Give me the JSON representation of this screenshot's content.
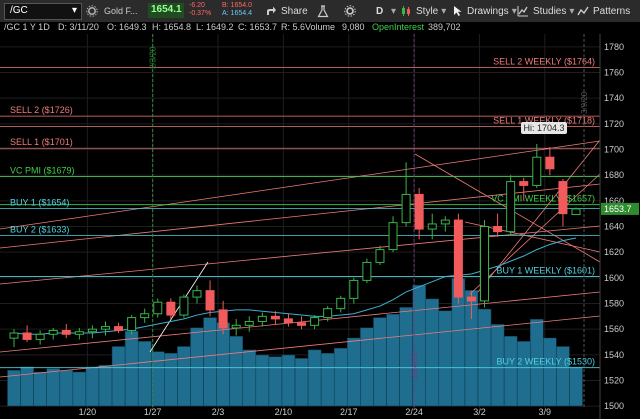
{
  "toolbar": {
    "symbol": "/GC",
    "symbol_chevron": "▾",
    "description": "Gold F...",
    "price": "1654.1",
    "change": "-6.20",
    "change_pct": "-0.37%",
    "bid": "B: 1654.0",
    "ask": "A: 1654.4",
    "share_label": "Share",
    "style_label": "Style",
    "drawings_label": "Drawings",
    "studies_label": "Studies",
    "patterns_label": "Patterns",
    "period_label": "D",
    "icons": [
      "gear-icon",
      "share-icon",
      "flask-icon",
      "drawings-icon",
      "studies-icon",
      "patterns-icon",
      "cursor-icon",
      "zoom-icon",
      "grid-icon"
    ]
  },
  "infobar": {
    "title": "/GC 1 Y 1D",
    "date": "D: 3/11/20",
    "open": "O: 1649.3",
    "high": "H: 1654.8",
    "low": "L: 1649.2",
    "close": "C: 1653.7",
    "range": "R: 5.6",
    "volume_label": "Volume",
    "volume_value": "9,080",
    "oi_label": "OpenInterest",
    "oi_value": "389,702"
  },
  "colors": {
    "up": "#39b54a",
    "down": "#f25b5b",
    "volume": "#1f6d8f",
    "pmi": "#3fd04a",
    "level": "#f07b7b",
    "buy": "#4fd2e0",
    "ma": "#3fb0d0",
    "last_price_bg": "#2e8b2e"
  },
  "chart_data": {
    "type": "candlestick",
    "x_ticks": [
      "1/20",
      "1/27",
      "2/3",
      "2/10",
      "2/17",
      "2/24",
      "3/2",
      "3/9"
    ],
    "y_ticks": [
      "1500",
      "1520",
      "1540",
      "1560",
      "1580",
      "1600",
      "1620",
      "1640",
      "1660",
      "1680",
      "1700",
      "1720",
      "1740",
      "1760",
      "1780"
    ],
    "ylim": [
      1490,
      1790
    ],
    "last_price": "1653.7",
    "high_label": "Hi: 1704.3",
    "vertical_marker_labels": [
      "2/3/20",
      "2/24/20",
      "3/9/20"
    ],
    "levels": [
      {
        "label": "SELL 2 WEEKLY ($1764)",
        "value": 1764,
        "kind": "sell",
        "side": "right"
      },
      {
        "label": "SELL 2 ($1726)",
        "value": 1726,
        "kind": "sell",
        "side": "left"
      },
      {
        "label": "SELL 1 WEEKLY ($1718)",
        "value": 1718,
        "kind": "sell",
        "side": "right"
      },
      {
        "label": "SELL 1 ($1701)",
        "value": 1701,
        "kind": "sell",
        "side": "left"
      },
      {
        "label": "VC PMI ($1679)",
        "value": 1679,
        "kind": "pmi",
        "side": "left"
      },
      {
        "label": "VC PMI WEEKLY ($1657)",
        "value": 1657,
        "kind": "pmi",
        "side": "right"
      },
      {
        "label": "BUY 1 ($1654)",
        "value": 1654,
        "kind": "buy",
        "side": "left"
      },
      {
        "label": "BUY 2 ($1633)",
        "value": 1633,
        "kind": "buy",
        "side": "left"
      },
      {
        "label": "BUY 1 WEEKLY ($1601)",
        "value": 1601,
        "kind": "buy",
        "side": "right"
      },
      {
        "label": "BUY 2 WEEKLY ($1530)",
        "value": 1530,
        "kind": "buy",
        "side": "right"
      }
    ],
    "candles": [
      {
        "o": 1553,
        "h": 1560,
        "l": 1546,
        "c": 1557
      },
      {
        "o": 1557,
        "h": 1563,
        "l": 1550,
        "c": 1552
      },
      {
        "o": 1552,
        "h": 1559,
        "l": 1548,
        "c": 1556
      },
      {
        "o": 1556,
        "h": 1561,
        "l": 1552,
        "c": 1559
      },
      {
        "o": 1559,
        "h": 1564,
        "l": 1553,
        "c": 1556
      },
      {
        "o": 1556,
        "h": 1561,
        "l": 1552,
        "c": 1558
      },
      {
        "o": 1558,
        "h": 1563,
        "l": 1553,
        "c": 1560
      },
      {
        "o": 1560,
        "h": 1566,
        "l": 1555,
        "c": 1562
      },
      {
        "o": 1562,
        "h": 1565,
        "l": 1557,
        "c": 1559
      },
      {
        "o": 1559,
        "h": 1571,
        "l": 1556,
        "c": 1569
      },
      {
        "o": 1569,
        "h": 1576,
        "l": 1565,
        "c": 1572
      },
      {
        "o": 1572,
        "h": 1584,
        "l": 1569,
        "c": 1581
      },
      {
        "o": 1581,
        "h": 1584,
        "l": 1568,
        "c": 1571
      },
      {
        "o": 1571,
        "h": 1587,
        "l": 1569,
        "c": 1585
      },
      {
        "o": 1585,
        "h": 1594,
        "l": 1580,
        "c": 1590
      },
      {
        "o": 1590,
        "h": 1598,
        "l": 1570,
        "c": 1575
      },
      {
        "o": 1575,
        "h": 1582,
        "l": 1556,
        "c": 1561
      },
      {
        "o": 1561,
        "h": 1568,
        "l": 1555,
        "c": 1563
      },
      {
        "o": 1563,
        "h": 1570,
        "l": 1558,
        "c": 1566
      },
      {
        "o": 1566,
        "h": 1573,
        "l": 1562,
        "c": 1570
      },
      {
        "o": 1570,
        "h": 1574,
        "l": 1564,
        "c": 1568
      },
      {
        "o": 1568,
        "h": 1572,
        "l": 1562,
        "c": 1565
      },
      {
        "o": 1565,
        "h": 1570,
        "l": 1560,
        "c": 1563
      },
      {
        "o": 1563,
        "h": 1571,
        "l": 1560,
        "c": 1569
      },
      {
        "o": 1569,
        "h": 1578,
        "l": 1566,
        "c": 1576
      },
      {
        "o": 1576,
        "h": 1586,
        "l": 1573,
        "c": 1584
      },
      {
        "o": 1584,
        "h": 1600,
        "l": 1580,
        "c": 1598
      },
      {
        "o": 1598,
        "h": 1615,
        "l": 1596,
        "c": 1612
      },
      {
        "o": 1612,
        "h": 1625,
        "l": 1610,
        "c": 1622
      },
      {
        "o": 1622,
        "h": 1648,
        "l": 1620,
        "c": 1643
      },
      {
        "o": 1643,
        "h": 1690,
        "l": 1640,
        "c": 1665
      },
      {
        "o": 1665,
        "h": 1670,
        "l": 1630,
        "c": 1638
      },
      {
        "o": 1638,
        "h": 1650,
        "l": 1630,
        "c": 1642
      },
      {
        "o": 1642,
        "h": 1648,
        "l": 1636,
        "c": 1645
      },
      {
        "o": 1645,
        "h": 1650,
        "l": 1580,
        "c": 1585
      },
      {
        "o": 1585,
        "h": 1590,
        "l": 1568,
        "c": 1582
      },
      {
        "o": 1582,
        "h": 1645,
        "l": 1577,
        "c": 1640
      },
      {
        "o": 1640,
        "h": 1650,
        "l": 1632,
        "c": 1636
      },
      {
        "o": 1636,
        "h": 1680,
        "l": 1634,
        "c": 1675
      },
      {
        "o": 1675,
        "h": 1678,
        "l": 1660,
        "c": 1672
      },
      {
        "o": 1672,
        "h": 1704.3,
        "l": 1670,
        "c": 1694
      },
      {
        "o": 1694,
        "h": 1702,
        "l": 1680,
        "c": 1685
      },
      {
        "o": 1675,
        "h": 1677,
        "l": 1640,
        "c": 1650
      },
      {
        "o": 1649.3,
        "h": 1654.8,
        "l": 1649.2,
        "c": 1653.7
      }
    ],
    "volume": [
      0.21,
      0.23,
      0.2,
      0.22,
      0.21,
      0.2,
      0.23,
      0.24,
      0.35,
      0.44,
      0.38,
      0.32,
      0.31,
      0.35,
      0.46,
      0.52,
      0.49,
      0.41,
      0.33,
      0.3,
      0.29,
      0.3,
      0.28,
      0.33,
      0.31,
      0.34,
      0.4,
      0.46,
      0.52,
      0.54,
      0.58,
      0.71,
      0.63,
      0.56,
      0.75,
      0.68,
      0.57,
      0.48,
      0.41,
      0.38,
      0.51,
      0.4,
      0.35,
      0.23
    ],
    "ma": [
      1557,
      1556,
      1556,
      1557,
      1557,
      1557,
      1557,
      1558,
      1559,
      1560,
      1562,
      1564,
      1566,
      1568,
      1571,
      1573,
      1574,
      1575,
      1575,
      1574,
      1573,
      1572,
      1571,
      1570,
      1570,
      1571,
      1572,
      1575,
      1578,
      1583,
      1589,
      1593,
      1597,
      1601,
      1602,
      1603,
      1606,
      1609,
      1613,
      1617,
      1622,
      1626,
      1629,
      1631
    ]
  }
}
